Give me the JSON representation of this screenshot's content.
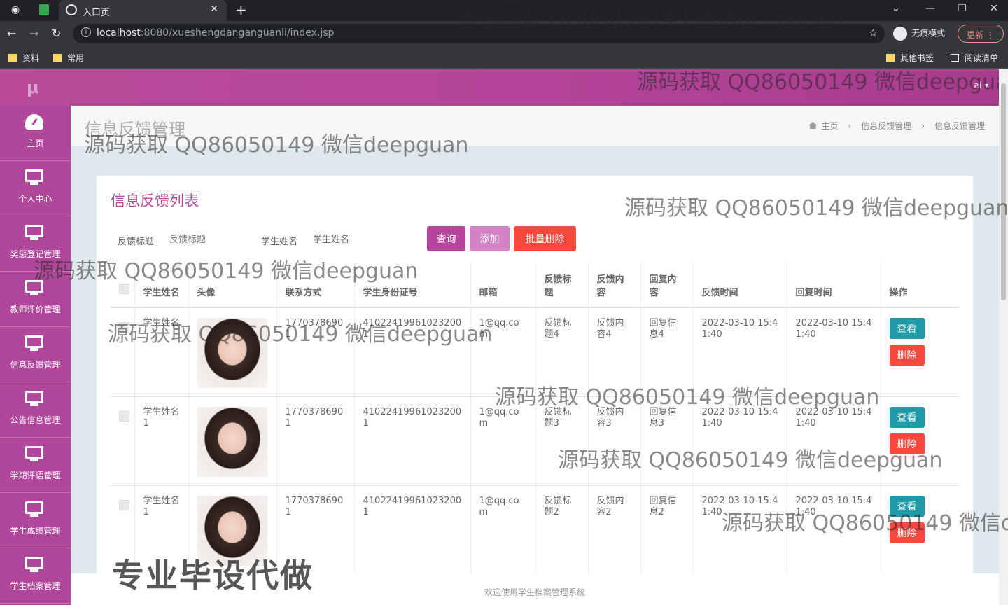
{
  "browser": {
    "tab_title": "入口页",
    "url_host": "localhost",
    "url_path": ":8080/xueshengdanganguanli/index.jsp",
    "incognito_label": "无痕模式",
    "update_label": "更新",
    "bookmarks": [
      "资料",
      "常用"
    ],
    "other_bookmarks": "其他书签",
    "reading_list": "阅读清单"
  },
  "header": {
    "logo": "μ",
    "user": "ai ▾"
  },
  "sidebar": {
    "items": [
      {
        "label": "主页",
        "icon": "dashboard-icon"
      },
      {
        "label": "个人中心",
        "icon": "monitor-icon"
      },
      {
        "label": "奖惩登记管理",
        "icon": "monitor-icon"
      },
      {
        "label": "教师评价管理",
        "icon": "monitor-icon"
      },
      {
        "label": "信息反馈管理",
        "icon": "monitor-icon"
      },
      {
        "label": "公告信息管理",
        "icon": "monitor-icon"
      },
      {
        "label": "学期评语管理",
        "icon": "monitor-icon"
      },
      {
        "label": "学生成绩管理",
        "icon": "monitor-icon"
      },
      {
        "label": "学生档案管理",
        "icon": "monitor-icon"
      }
    ]
  },
  "page": {
    "title": "信息反馈管理",
    "breadcrumb": [
      "主页",
      "信息反馈管理",
      "信息反馈管理"
    ]
  },
  "panel": {
    "title": "信息反馈列表",
    "search": {
      "label1": "反馈标题",
      "placeholder1": "反馈标题",
      "label2": "学生姓名",
      "placeholder2": "学生姓名"
    },
    "buttons": {
      "query": "查询",
      "add": "添加",
      "batch_delete": "批量删除"
    }
  },
  "table": {
    "headers": [
      "学生姓名",
      "头像",
      "联系方式",
      "学生身份证号",
      "邮箱",
      "反馈标题",
      "反馈内容",
      "回复内容",
      "反馈时间",
      "回复时间",
      "操作"
    ],
    "rows": [
      {
        "name": "学生姓名",
        "phone": "17703786901",
        "idcard": "410224199610232001",
        "email": "1@qq.com",
        "title": "反馈标题4",
        "content": "反馈内容4",
        "reply": "回复信息4",
        "time": "2022-03-10 15:41:40",
        "reply_time": "2022-03-10 15:41:40"
      },
      {
        "name": "学生姓名1",
        "phone": "17703786901",
        "idcard": "410224199610232001",
        "email": "1@qq.com",
        "title": "反馈标题3",
        "content": "反馈内容3",
        "reply": "回复信息3",
        "time": "2022-03-10 15:41:40",
        "reply_time": "2022-03-10 15:41:40"
      },
      {
        "name": "学生姓名1",
        "phone": "17703786901",
        "idcard": "410224199610232001",
        "email": "1@qq.com",
        "title": "反馈标题2",
        "content": "反馈内容2",
        "reply": "回复信息2",
        "time": "2022-03-10 15:41:40",
        "reply_time": "2022-03-10 15:41:40"
      }
    ],
    "view_label": "查看",
    "delete_label": "删除"
  },
  "footer": "欢迎使用学生档案管理系统",
  "watermarks": {
    "text": "源码获取 QQ86050149 微信deepguan",
    "text_cut": "源码获取 QQ86050149 微信d",
    "promo": "专业毕设代做"
  },
  "colors": {
    "primary": "#b4459a",
    "danger": "#f5483f",
    "info": "#1e9aa8"
  }
}
